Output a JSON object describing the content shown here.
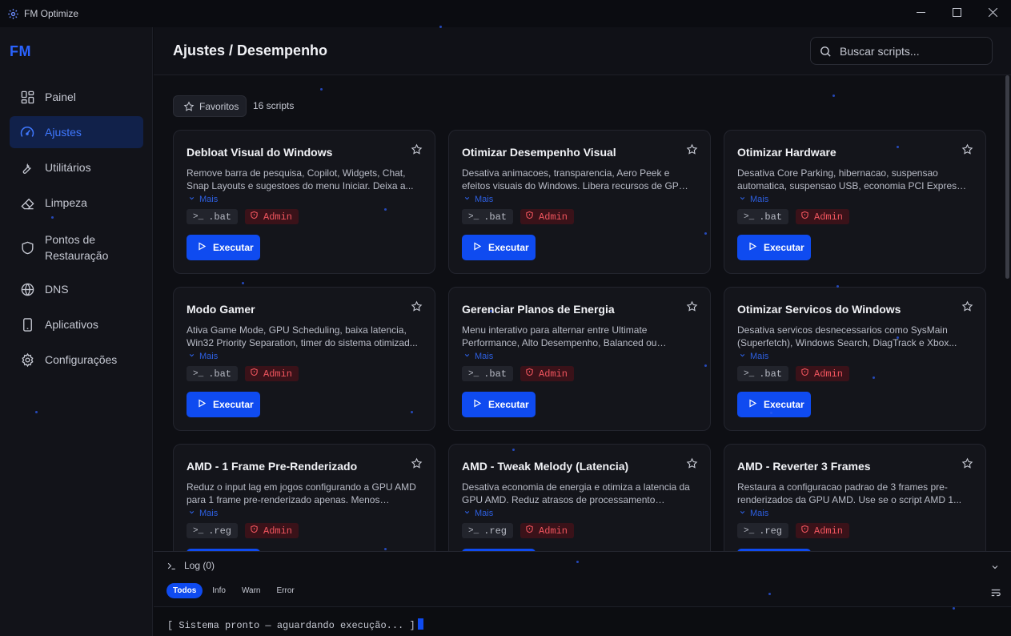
{
  "window": {
    "title": "FM Optimize"
  },
  "sidebar": {
    "logo": "FM",
    "items": [
      {
        "label": "Painel",
        "icon": "dashboard-grid-icon"
      },
      {
        "label": "Ajustes",
        "icon": "gauge-icon",
        "active": true
      },
      {
        "label": "Utilitários",
        "icon": "wrench-icon"
      },
      {
        "label": "Limpeza",
        "icon": "eraser-icon"
      },
      {
        "label": "Pontos de Restauração",
        "icon": "shield-icon"
      },
      {
        "label": "DNS",
        "icon": "globe-icon"
      },
      {
        "label": "Aplicativos",
        "icon": "smartphone-icon"
      },
      {
        "label": "Configurações",
        "icon": "gear-icon"
      }
    ]
  },
  "header": {
    "title": "Ajustes / Desempenho",
    "search_placeholder": "Buscar scripts..."
  },
  "toolbar": {
    "favorites_label": "Favoritos",
    "count_label": "16 scripts"
  },
  "labels": {
    "more": "Mais",
    "admin": "Admin",
    "execute": "Executar"
  },
  "cards": [
    {
      "title": "Debloat Visual do Windows",
      "desc": "Remove barra de pesquisa, Copilot, Widgets, Chat, Snap Layouts e sugestoes do menu Iniciar. Deixa a...",
      "ext": ".bat"
    },
    {
      "title": "Otimizar Desempenho Visual",
      "desc": "Desativa animacoes, transparencia, Aero Peek e efeitos visuais do Windows. Libera recursos de GPU e CPU...",
      "ext": ".bat"
    },
    {
      "title": "Otimizar Hardware",
      "desc": "Desativa Core Parking, hibernacao, suspensao automatica, suspensao USB, economia PCI Express e...",
      "ext": ".bat"
    },
    {
      "title": "Modo Gamer",
      "desc": "Ativa Game Mode, GPU Scheduling, baixa latencia, Win32 Priority Separation, timer do sistema otimizad...",
      "ext": ".bat"
    },
    {
      "title": "Gerenciar Planos de Energia",
      "desc": "Menu interativo para alternar entre Ultimate Performance, Alto Desempenho, Balanced ou Econom...",
      "ext": ".bat"
    },
    {
      "title": "Otimizar Servicos do Windows",
      "desc": "Desativa servicos desnecessarios como SysMain (Superfetch), Windows Search, DiagTrack e Xbox...",
      "ext": ".bat"
    },
    {
      "title": "AMD - 1 Frame Pre-Renderizado",
      "desc": "Reduz o input lag em jogos configurando a GPU AMD para 1 frame pre-renderizado apenas. Menos latencia...",
      "ext": ".reg"
    },
    {
      "title": "AMD - Tweak Melody (Latencia)",
      "desc": "Desativa economia de energia e otimiza a latencia da GPU AMD. Reduz atrasos de processamento grafico...",
      "ext": ".reg"
    },
    {
      "title": "AMD - Reverter 3 Frames",
      "desc": "Restaura a configuracao padrao de 3 frames pre-renderizados da GPU AMD. Use se o script AMD 1...",
      "ext": ".reg"
    }
  ],
  "log": {
    "title": "Log (0)",
    "filters": [
      {
        "label": "Todos",
        "active": true
      },
      {
        "label": "Info"
      },
      {
        "label": "Warn"
      },
      {
        "label": "Error"
      }
    ],
    "console_text": "[ Sistema pronto — aguardando execução... ]"
  },
  "colors": {
    "accent": "#0f4bf0",
    "accent_text": "#3f78ff",
    "admin_bg": "#3a1219",
    "admin_text": "#f0555e"
  }
}
